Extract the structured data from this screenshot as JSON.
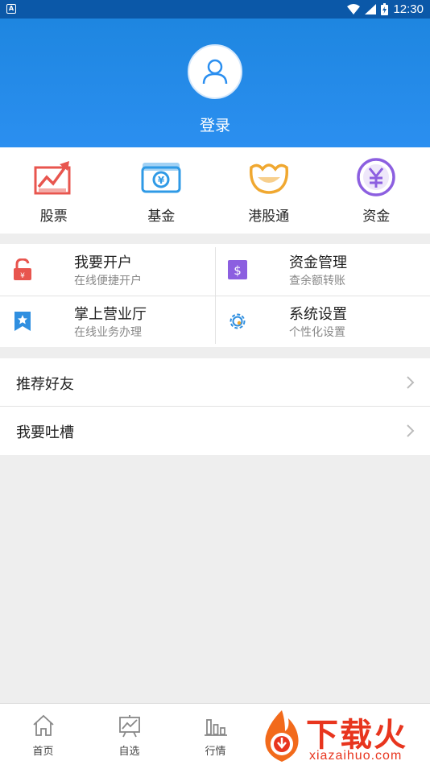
{
  "status_bar": {
    "time": "12:30",
    "app_indicator": "A"
  },
  "header": {
    "login_label": "登录"
  },
  "categories": [
    {
      "label": "股票",
      "icon": "stock-chart-icon",
      "color": "#e8554e"
    },
    {
      "label": "基金",
      "icon": "fund-banknote-icon",
      "color": "#2f9ae6"
    },
    {
      "label": "港股通",
      "icon": "hk-connect-icon",
      "color": "#f0a830"
    },
    {
      "label": "资金",
      "icon": "yuan-coin-icon",
      "color": "#8c5fe0"
    }
  ],
  "grid": [
    {
      "title": "我要开户",
      "subtitle": "在线便捷开户",
      "icon": "unlock-icon"
    },
    {
      "title": "资金管理",
      "subtitle": "查余额转账",
      "icon": "dollar-square-icon"
    },
    {
      "title": "掌上营业厅",
      "subtitle": "在线业务办理",
      "icon": "bookmark-star-icon"
    },
    {
      "title": "系统设置",
      "subtitle": "个性化设置",
      "icon": "gear-icon"
    }
  ],
  "list": [
    {
      "label": "推荐好友"
    },
    {
      "label": "我要吐槽"
    }
  ],
  "bottom_nav": [
    {
      "label": "首页",
      "icon": "home-icon"
    },
    {
      "label": "自选",
      "icon": "watchlist-chart-icon"
    },
    {
      "label": "行情",
      "icon": "market-bars-icon"
    }
  ],
  "watermark": {
    "text": "下载火",
    "sub": "xiazaihuo.com"
  }
}
